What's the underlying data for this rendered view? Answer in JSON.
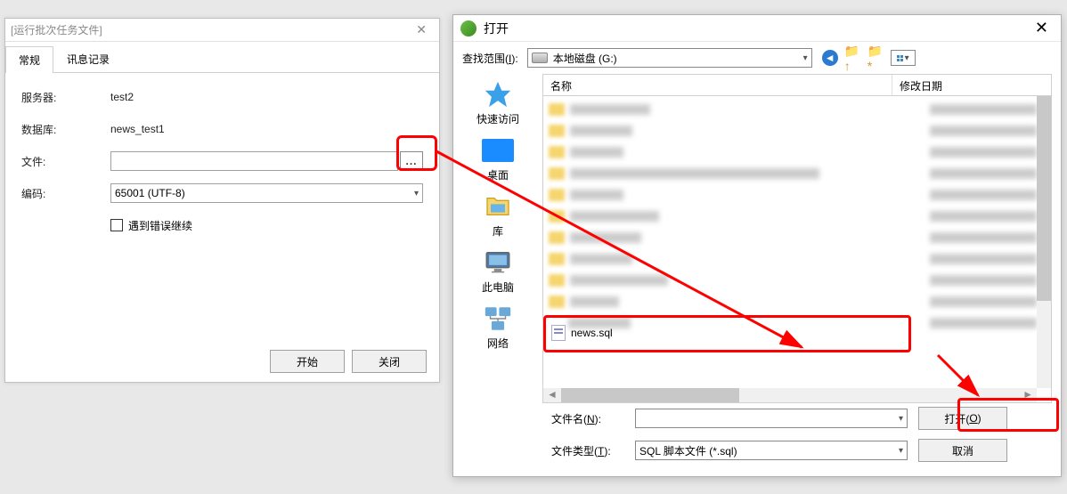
{
  "left_dialog": {
    "title": "[运行批次任务文件]",
    "tabs": {
      "general": "常规",
      "log": "讯息记录"
    },
    "labels": {
      "server": "服务器:",
      "database": "数据库:",
      "file": "文件:",
      "encoding": "编码:"
    },
    "values": {
      "server": "test2",
      "database": "news_test1",
      "file": "",
      "encoding": "65001 (UTF-8)"
    },
    "checkbox_label": "遇到错误继续",
    "browse_label": "...",
    "buttons": {
      "start": "开始",
      "close": "关闭"
    }
  },
  "open_dialog": {
    "title": "打开",
    "lookup_label_pre": "查找范围(",
    "lookup_label_u": "I",
    "lookup_label_post": "):",
    "lookup_value": "本地磁盘 (G:)",
    "places": {
      "quick": "快速访问",
      "desktop": "桌面",
      "library": "库",
      "thispc": "此电脑",
      "network": "网络"
    },
    "columns": {
      "name": "名称",
      "date": "修改日期"
    },
    "selected_file": "news.sql",
    "filename_label_pre": "文件名(",
    "filename_label_u": "N",
    "filename_label_post": "):",
    "filename_value": "",
    "filetype_label_pre": "文件类型(",
    "filetype_label_u": "T",
    "filetype_label_post": "):",
    "filetype_value": "SQL 脚本文件 (*.sql)",
    "buttons": {
      "open_pre": "打开(",
      "open_u": "O",
      "open_post": ")",
      "cancel": "取消"
    }
  }
}
